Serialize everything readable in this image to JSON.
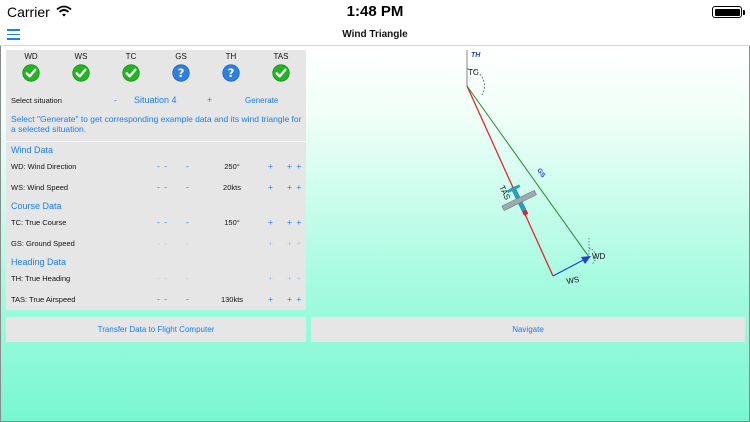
{
  "status_bar": {
    "carrier": "Carrier",
    "time": "1:48 PM"
  },
  "nav": {
    "title": "Wind Triangle",
    "menu_icon": "hamburger-menu-icon"
  },
  "status_items": [
    {
      "label": "WD",
      "state": "ok"
    },
    {
      "label": "WS",
      "state": "ok"
    },
    {
      "label": "TC",
      "state": "ok"
    },
    {
      "label": "GS",
      "state": "unknown"
    },
    {
      "label": "TH",
      "state": "unknown"
    },
    {
      "label": "TAS",
      "state": "ok"
    }
  ],
  "situation": {
    "label": "Select situation",
    "minus": "-",
    "value": "Situation 4",
    "plus": "+",
    "generate": "Generate",
    "description": "Select \"Generate\" to get corresponding example data and its wind triangle for a selected situation."
  },
  "sections": {
    "wind": "Wind Data",
    "course": "Course Data",
    "heading": "Heading Data"
  },
  "rows": [
    {
      "label": "WD: Wind Direction",
      "value": "250°",
      "enabled": true
    },
    {
      "label": "WS: Wind Speed",
      "value": "20kts",
      "enabled": true
    },
    {
      "label": "TC: True Course",
      "value": "150°",
      "enabled": true
    },
    {
      "label": "GS: Ground Speed",
      "value": "",
      "enabled": false
    },
    {
      "label": "TH: True Heading",
      "value": "",
      "enabled": false
    },
    {
      "label": "TAS: True Airspeed",
      "value": "130kts",
      "enabled": true
    }
  ],
  "stepper": {
    "dec_big": "- -",
    "dec": "-",
    "inc": "+",
    "inc_big": "+ +"
  },
  "buttons": {
    "transfer": "Transfer Data to Flight Computer",
    "navigate": "Navigate"
  },
  "diagram": {
    "labels": {
      "th": "TH",
      "tc": "TC",
      "tas": "TAS",
      "gs": "GS",
      "wd": "WD",
      "ws": "WS"
    },
    "colors": {
      "tas": "#e8242b",
      "course": "#2a8a2a",
      "wind": "#1f3fd8",
      "aircraft": "#2aa0c0"
    }
  },
  "colors": {
    "accent": "#1a7ef5",
    "ok": "#22b422",
    "unknown": "#2f7fe0",
    "panel": "#e6e6e6"
  }
}
